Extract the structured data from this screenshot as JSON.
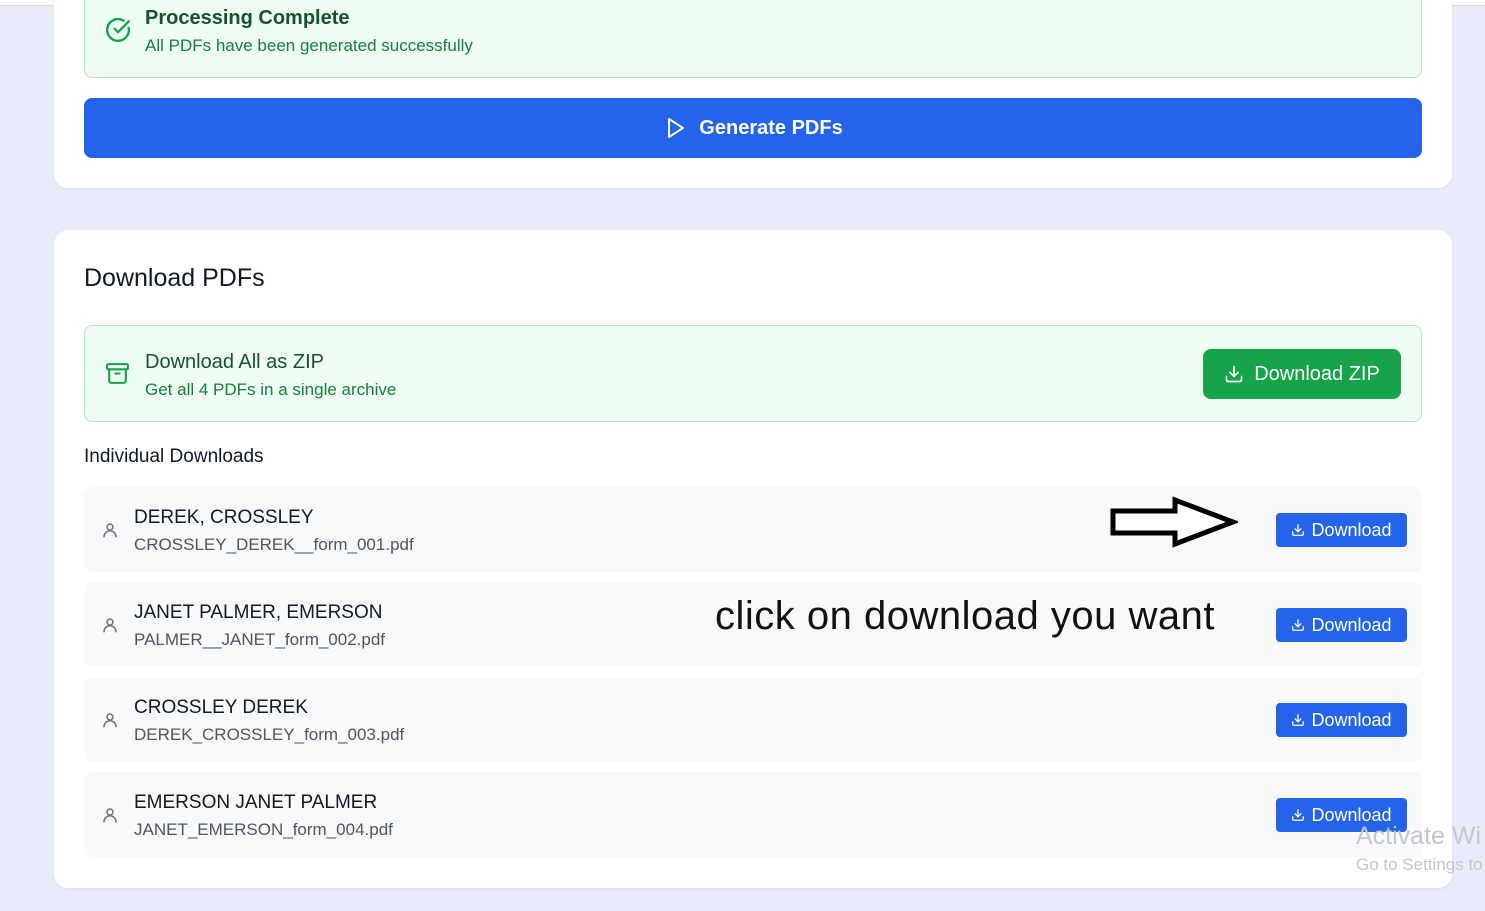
{
  "status": {
    "title": "Processing Complete",
    "subtitle": "All PDFs have been generated successfully"
  },
  "generate": {
    "label": "Generate PDFs"
  },
  "downloads": {
    "title": "Download PDFs",
    "zip": {
      "title": "Download All as ZIP",
      "subtitle": "Get all 4 PDFs in a single archive",
      "button_label": "Download ZIP"
    },
    "individual_heading": "Individual Downloads",
    "items": [
      {
        "name": "DEREK, CROSSLEY",
        "file": "CROSSLEY_DEREK__form_001.pdf",
        "button_label": "Download"
      },
      {
        "name": "JANET PALMER, EMERSON",
        "file": "PALMER__JANET_form_002.pdf",
        "button_label": "Download"
      },
      {
        "name": "CROSSLEY DEREK",
        "file": "DEREK_CROSSLEY_form_003.pdf",
        "button_label": "Download"
      },
      {
        "name": "EMERSON JANET PALMER",
        "file": "JANET_EMERSON_form_004.pdf",
        "button_label": "Download"
      }
    ]
  },
  "annotation": {
    "text": "click on download you want"
  },
  "watermark": {
    "line1": "Activate Wi",
    "line2": "Go to Settings to"
  },
  "icons": {
    "status": "check-circle-icon",
    "generate": "play-icon",
    "zip": "archive-icon",
    "download": "download-icon",
    "user": "user-icon",
    "annotation": "arrow-right-icon"
  },
  "colors": {
    "primary": "#2563eb",
    "success": "#16a34a",
    "success_bg": "#effcf3",
    "success_text": "#14532d",
    "page_bg": "#e9edfb"
  }
}
